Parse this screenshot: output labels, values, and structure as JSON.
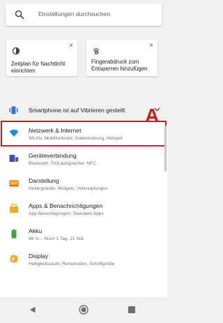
{
  "search": {
    "placeholder": "Einstellungen durchsuchen"
  },
  "suggestions": [
    {
      "title": "Zeitplan für Nachtlicht einrichten",
      "icon": "night-light-icon",
      "close": "×"
    },
    {
      "title": "Fingerabdruck zum Entsperren hinzufügen",
      "icon": "fingerprint-icon",
      "close": "×"
    }
  ],
  "vibrate_banner": {
    "label": "Smartphone ist auf Vibrieren gestellt",
    "icon": "vibrate-icon"
  },
  "settings": [
    {
      "title": "Netzwerk & Internet",
      "subtitle": "WLAN, Mobilfunknetz, Datennutzung, Hotspot",
      "icon": "wifi-icon",
      "color": "#1e88e5"
    },
    {
      "title": "Geräteverbindung",
      "subtitle": "Bluetooth, TV/Lautsprecher, NFC",
      "icon": "devices-icon",
      "color": "#3f51b5"
    },
    {
      "title": "Darstellung",
      "subtitle": "Hintergründe, Widgets, Verknüpfungen",
      "icon": "display-icon",
      "color": "#ef6c00"
    },
    {
      "title": "Apps & Benachrichtigungen",
      "subtitle": "App-Berechtigungen, Standard-Apps",
      "icon": "apps-icon",
      "color": "#f9a825"
    },
    {
      "title": "Akku",
      "subtitle": "46 % – Noch 1 Tag, 21 Std.",
      "icon": "battery-icon",
      "color": "#43a047"
    },
    {
      "title": "Display",
      "subtitle": "Helligkeitsstufe, Ruhemodus, Schriftgröße",
      "icon": "brightness-icon",
      "color": "#f9a825"
    }
  ],
  "annotation": {
    "label": "A",
    "color": "#d0191b"
  },
  "nav": {
    "back": "back-icon",
    "home": "home-icon",
    "recents": "recents-icon"
  }
}
